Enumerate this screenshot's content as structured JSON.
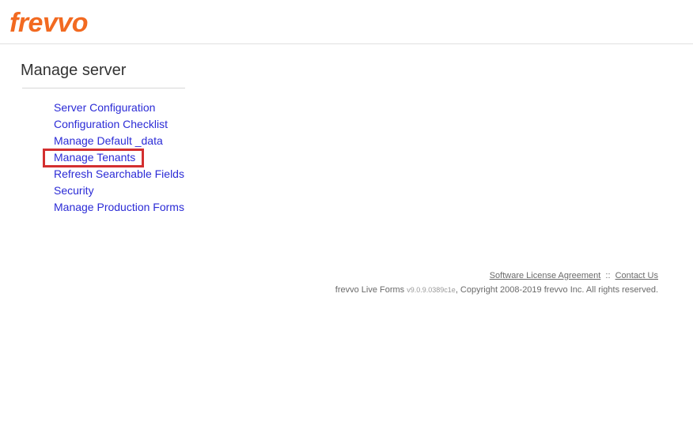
{
  "header": {
    "logo_text": "frevvo"
  },
  "page": {
    "title": "Manage server"
  },
  "menu": {
    "items": [
      {
        "label": "Server Configuration"
      },
      {
        "label": "Configuration Checklist"
      },
      {
        "label": "Manage Default _data"
      },
      {
        "label": "Manage Tenants"
      },
      {
        "label": "Refresh Searchable Fields"
      },
      {
        "label": "Security"
      },
      {
        "label": "Manage Production Forms"
      }
    ]
  },
  "footer": {
    "license_link": "Software License Agreement",
    "separator": "::",
    "contact_link": "Contact Us",
    "product": "frevvo Live Forms",
    "version": "v9.0.9.0389c1e",
    "copyright": ", Copyright 2008-2019 frevvo Inc. All rights reserved."
  }
}
